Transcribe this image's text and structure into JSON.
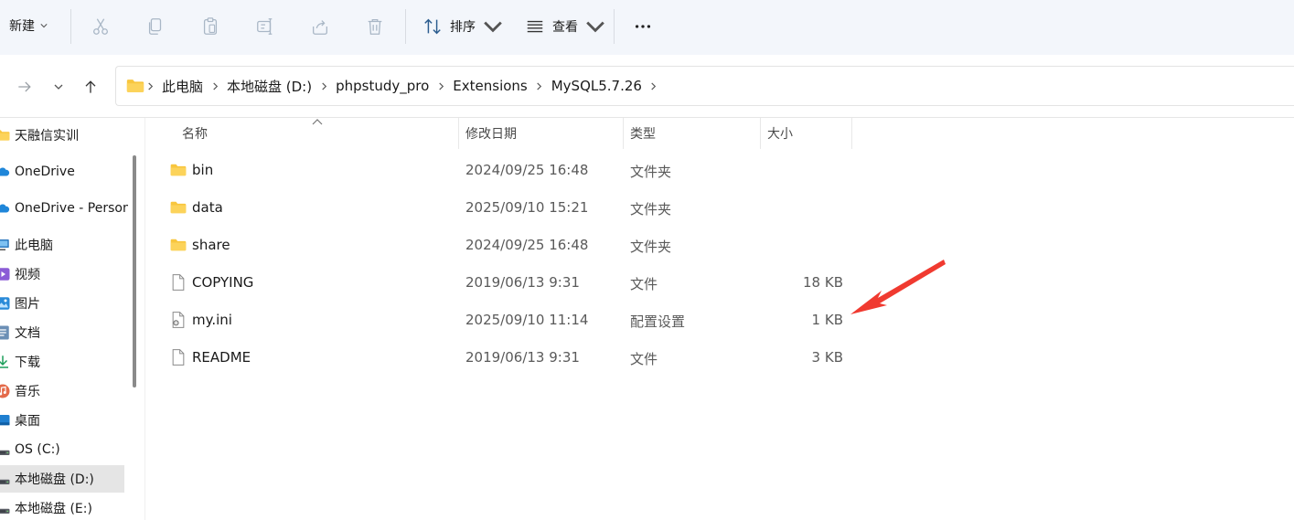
{
  "toolbar": {
    "new_label": "新建",
    "sort_label": "排序",
    "view_label": "查看",
    "icons": [
      "cut-icon",
      "copy-icon",
      "paste-icon",
      "rename-icon",
      "share-icon",
      "delete-icon"
    ]
  },
  "address": {
    "crumbs": [
      "此电脑",
      "本地磁盘 (D:)",
      "phpstudy_pro",
      "Extensions",
      "MySQL5.7.26"
    ]
  },
  "sidebar": {
    "items": [
      {
        "label": "天融信实训",
        "icon": "folder-icon"
      },
      {
        "label": "OneDrive",
        "icon": "cloud-icon"
      },
      {
        "label": "OneDrive - Personal",
        "icon": "cloud-icon"
      },
      {
        "label": "此电脑",
        "icon": "computer-icon"
      },
      {
        "label": "视频",
        "icon": "video-icon"
      },
      {
        "label": "图片",
        "icon": "pictures-icon"
      },
      {
        "label": "文档",
        "icon": "documents-icon"
      },
      {
        "label": "下载",
        "icon": "download-icon"
      },
      {
        "label": "音乐",
        "icon": "music-icon"
      },
      {
        "label": "桌面",
        "icon": "desktop-icon"
      },
      {
        "label": "OS (C:)",
        "icon": "drive-icon"
      },
      {
        "label": "本地磁盘 (D:)",
        "icon": "drive-icon",
        "selected": true
      },
      {
        "label": "本地磁盘 (E:)",
        "icon": "drive-icon"
      }
    ]
  },
  "columns": {
    "name": "名称",
    "modified": "修改日期",
    "type": "类型",
    "size": "大小"
  },
  "files": [
    {
      "name": "bin",
      "modified": "2024/09/25 16:48",
      "type": "文件夹",
      "size": "",
      "icon": "folder-icon"
    },
    {
      "name": "data",
      "modified": "2025/09/10 15:21",
      "type": "文件夹",
      "size": "",
      "icon": "folder-icon"
    },
    {
      "name": "share",
      "modified": "2024/09/25 16:48",
      "type": "文件夹",
      "size": "",
      "icon": "folder-icon"
    },
    {
      "name": "COPYING",
      "modified": "2019/06/13 9:31",
      "type": "文件",
      "size": "18 KB",
      "icon": "file-icon"
    },
    {
      "name": "my.ini",
      "modified": "2025/09/10 11:14",
      "type": "配置设置",
      "size": "1 KB",
      "icon": "config-file-icon"
    },
    {
      "name": "README",
      "modified": "2019/06/13 9:31",
      "type": "文件",
      "size": "3 KB",
      "icon": "file-icon"
    }
  ],
  "colors": {
    "toolbar_bg": "#f3f6fb",
    "folder_yellow": "#f8c63e",
    "annotation_red": "#f03a30",
    "selected_bg": "#e5e5e5"
  }
}
